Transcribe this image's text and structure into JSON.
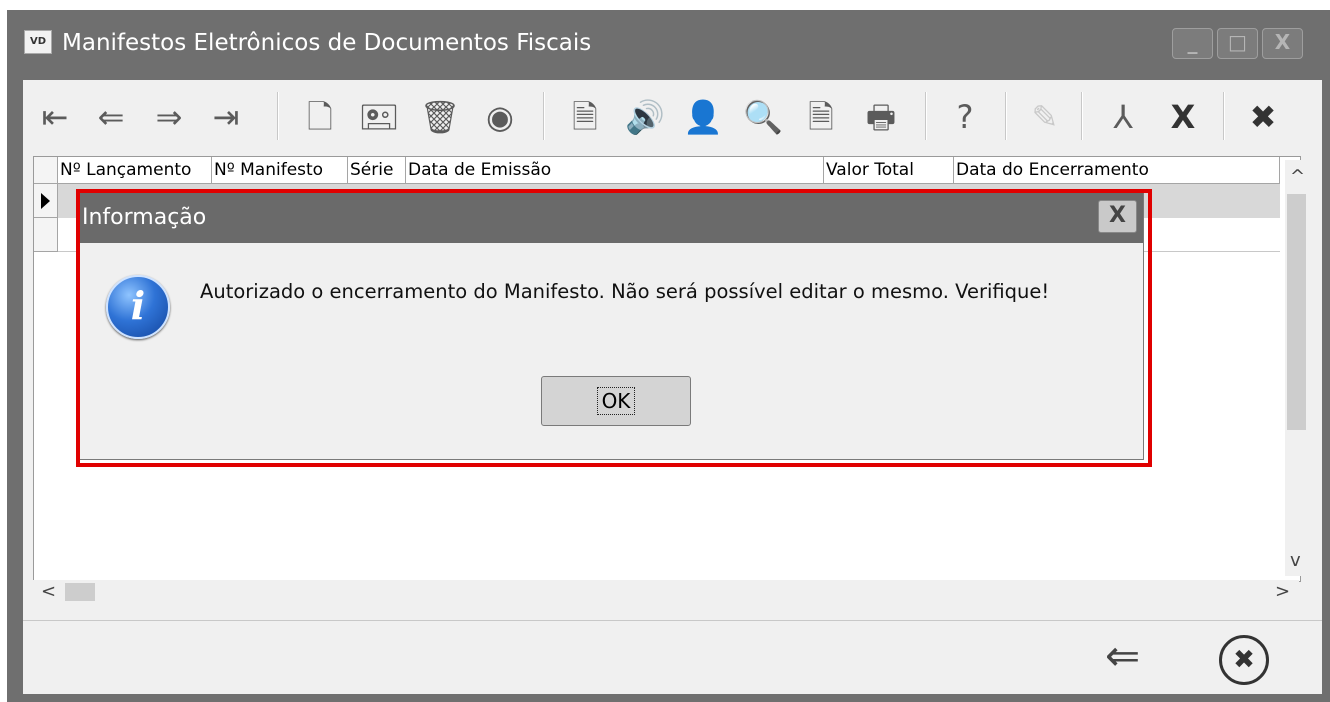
{
  "window": {
    "title": "Manifestos Eletrônicos de Documentos Fiscais",
    "app_icon_text": "VD",
    "controls": [
      "minimize-icon",
      "maximize-icon",
      "close-icon"
    ],
    "control_glyphs": {
      "minimize": "_",
      "maximize": "□",
      "close": "X"
    }
  },
  "toolbar": {
    "buttons": [
      {
        "icon": "first-record-icon",
        "glyph": "⇤"
      },
      {
        "icon": "previous-record-icon",
        "glyph": "⇐"
      },
      {
        "icon": "next-record-icon",
        "glyph": "⇒"
      },
      {
        "icon": "last-record-icon",
        "glyph": "⇥"
      },
      {
        "icon": "new-document-icon",
        "glyph": "🗋"
      },
      {
        "icon": "edit-icon",
        "glyph": "🖭"
      },
      {
        "icon": "delete-icon",
        "glyph": "🗑"
      },
      {
        "icon": "view-icon",
        "glyph": "◉"
      },
      {
        "icon": "document-export-icon",
        "glyph": "🗎"
      },
      {
        "icon": "transmit-icon",
        "glyph": "🔊"
      },
      {
        "icon": "user-icon",
        "glyph": "👤"
      },
      {
        "icon": "search-icon",
        "glyph": "🔍"
      },
      {
        "icon": "document-cancel-icon",
        "glyph": "🗎"
      },
      {
        "icon": "print-icon",
        "glyph": "🖶"
      },
      {
        "icon": "help-icon",
        "glyph": "?"
      },
      {
        "icon": "edit-disabled-icon",
        "glyph": "✎"
      },
      {
        "icon": "pdf-icon",
        "glyph": "⅄"
      },
      {
        "icon": "excel-icon",
        "glyph": "X"
      },
      {
        "icon": "close-circle-icon",
        "glyph": "✖"
      }
    ]
  },
  "grid": {
    "columns": [
      "Nº Lançamento",
      "Nº Manifesto",
      "Série",
      "Data de Emissão",
      "Valor Total",
      "Data do Encerramento"
    ]
  },
  "scroll": {
    "up": "^",
    "down": "v",
    "left": "<",
    "right": ">"
  },
  "bottom": {
    "back_icon": "⇐",
    "close_icon": "✖"
  },
  "dialog": {
    "title": "Informação",
    "close_glyph": "X",
    "icon": "info-icon",
    "icon_glyph": "i",
    "message": "Autorizado o encerramento do Manifesto. Não será possível editar o mesmo. Verifique!",
    "ok_label": "OK"
  },
  "colors": {
    "highlight_frame": "#e00000",
    "title_bar": "#6f6f6f",
    "dialog_title": "#6a6a6a"
  }
}
